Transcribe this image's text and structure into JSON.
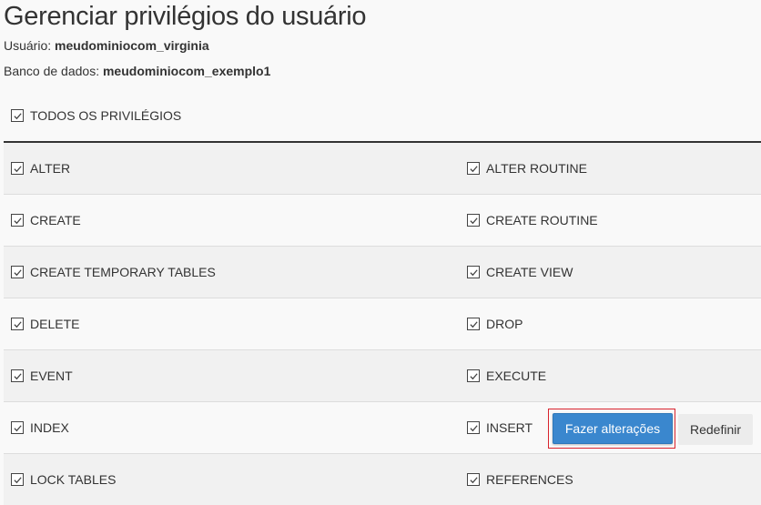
{
  "page": {
    "title": "Gerenciar privilégios do usuário",
    "user_label": "Usuário:",
    "user_value": "meudominiocom_virginia",
    "db_label": "Banco de dados:",
    "db_value": "meudominiocom_exemplo1"
  },
  "all_privileges": {
    "label": "TODOS OS PRIVILÉGIOS",
    "checked": true
  },
  "privileges": [
    {
      "left": {
        "label": "ALTER",
        "checked": true
      },
      "right": {
        "label": "ALTER ROUTINE",
        "checked": true
      }
    },
    {
      "left": {
        "label": "CREATE",
        "checked": true
      },
      "right": {
        "label": "CREATE ROUTINE",
        "checked": true
      }
    },
    {
      "left": {
        "label": "CREATE TEMPORARY TABLES",
        "checked": true
      },
      "right": {
        "label": "CREATE VIEW",
        "checked": true
      }
    },
    {
      "left": {
        "label": "DELETE",
        "checked": true
      },
      "right": {
        "label": "DROP",
        "checked": true
      }
    },
    {
      "left": {
        "label": "EVENT",
        "checked": true
      },
      "right": {
        "label": "EXECUTE",
        "checked": true
      }
    },
    {
      "left": {
        "label": "INDEX",
        "checked": true
      },
      "right": {
        "label": "INSERT",
        "checked": true
      }
    },
    {
      "left": {
        "label": "LOCK TABLES",
        "checked": true
      },
      "right": {
        "label": "REFERENCES",
        "checked": true
      }
    }
  ],
  "actions": {
    "submit_label": "Fazer alterações",
    "reset_label": "Redefinir"
  },
  "colors": {
    "primary": "#3a87ce",
    "highlight": "#d9232d"
  }
}
